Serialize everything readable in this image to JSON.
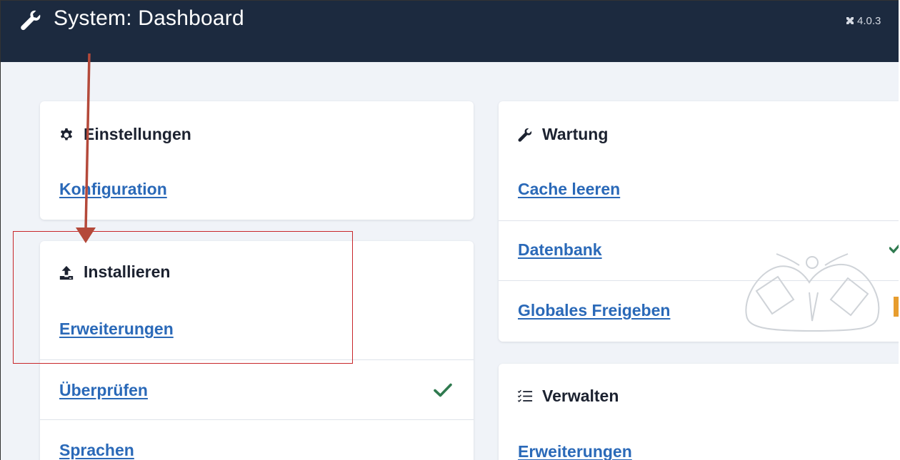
{
  "header": {
    "title": "System: Dashboard",
    "version": "4.0.3"
  },
  "cards": {
    "einstellungen": {
      "heading": "Einstellungen",
      "links": [
        "Konfiguration"
      ]
    },
    "installieren": {
      "heading": "Installieren",
      "links": [
        "Erweiterungen",
        "Überprüfen",
        "Sprachen"
      ]
    },
    "wartung": {
      "heading": "Wartung",
      "links": [
        "Cache leeren",
        "Datenbank",
        "Globales Freigeben"
      ]
    },
    "verwalten": {
      "heading": "Verwalten",
      "links": [
        "Erweiterungen"
      ]
    }
  },
  "icons": {
    "header": "wrench-icon",
    "einstellungen": "gear-icon",
    "installieren": "upload-icon",
    "wartung": "wrench-icon",
    "verwalten": "checklist-icon",
    "status_ok": "checkmark-icon"
  },
  "colors": {
    "topbar": "#1c2a3f",
    "background": "#f0f3f8",
    "link": "#2a69b8",
    "check": "#2f7a4f",
    "annotation": "#c8262a",
    "arrow": "#b4493a"
  }
}
